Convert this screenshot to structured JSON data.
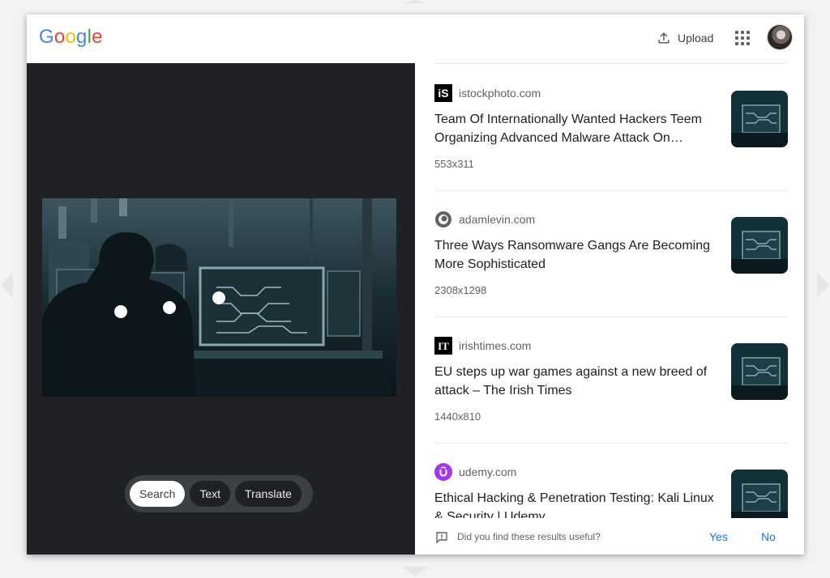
{
  "header": {
    "logo_letters": [
      "G",
      "o",
      "o",
      "g",
      "l",
      "e"
    ],
    "upload_label": "Upload",
    "apps_icon": "apps-grid-icon",
    "avatar_icon": "account-avatar"
  },
  "colors": {
    "google_blue": "#4285f4",
    "google_red": "#ea4335",
    "google_yellow": "#fbbc05",
    "google_green": "#34a853",
    "link_blue": "#1a73e8",
    "dark_pane": "#202124"
  },
  "lens_modes": [
    {
      "label": "Search",
      "active": true
    },
    {
      "label": "Text",
      "active": false
    },
    {
      "label": "Translate",
      "active": false
    }
  ],
  "results": [
    {
      "favicon": "istock-favicon",
      "domain": "istockphoto.com",
      "title": "Team Of Internationally Wanted Hackers Teem Organizing Advanced Malware Attack On Corporate Servers",
      "dims": "553x311"
    },
    {
      "favicon": "adamlevin-favicon",
      "domain": "adamlevin.com",
      "title": "Three Ways Ransomware Gangs Are Becoming More Sophisticated",
      "dims": "2308x1298"
    },
    {
      "favicon": "irishtimes-favicon",
      "domain": "irishtimes.com",
      "title": "EU steps up war games against a new breed of attack – The Irish Times",
      "dims": "1440x810"
    },
    {
      "favicon": "udemy-favicon",
      "domain": "udemy.com",
      "title": "Ethical Hacking & Penetration Testing: Kali Linux & Security | Udemy",
      "dims": ""
    }
  ],
  "feedback": {
    "question": "Did you find these results useful?",
    "yes": "Yes",
    "no": "No"
  }
}
